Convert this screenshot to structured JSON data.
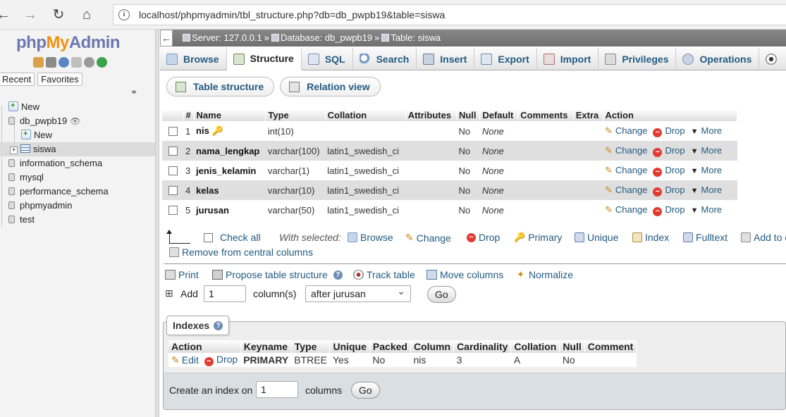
{
  "browser": {
    "url": "localhost/phpmyadmin/tbl_structure.php?db=db_pwpb19&table=siswa"
  },
  "logo": {
    "php": "php",
    "my": "My",
    "admin": "Admin"
  },
  "nav": {
    "recent_tab": "Recent",
    "favorites_tab": "Favorites",
    "tree": [
      {
        "label": "New"
      },
      {
        "label": "db_pwpb19"
      },
      {
        "label": "New"
      },
      {
        "label": "siswa"
      },
      {
        "label": "information_schema"
      },
      {
        "label": "mysql"
      },
      {
        "label": "performance_schema"
      },
      {
        "label": "phpmyadmin"
      },
      {
        "label": "test"
      }
    ]
  },
  "breadcrumb": {
    "server": "Server: 127.0.0.1",
    "database": "Database: db_pwpb19",
    "table": "Table: siswa"
  },
  "tabs": [
    "Browse",
    "Structure",
    "SQL",
    "Search",
    "Insert",
    "Export",
    "Import",
    "Privileges",
    "Operations"
  ],
  "subtabs": [
    "Table structure",
    "Relation view"
  ],
  "structure": {
    "headers": [
      "#",
      "Name",
      "Type",
      "Collation",
      "Attributes",
      "Null",
      "Default",
      "Comments",
      "Extra",
      "Action"
    ],
    "rows": [
      {
        "num": "1",
        "name": "nis",
        "type": "int(10)",
        "collation": "",
        "null": "No",
        "default": "None"
      },
      {
        "num": "2",
        "name": "nama_lengkap",
        "type": "varchar(100)",
        "collation": "latin1_swedish_ci",
        "null": "No",
        "default": "None"
      },
      {
        "num": "3",
        "name": "jenis_kelamin",
        "type": "varchar(1)",
        "collation": "latin1_swedish_ci",
        "null": "No",
        "default": "None"
      },
      {
        "num": "4",
        "name": "kelas",
        "type": "varchar(10)",
        "collation": "latin1_swedish_ci",
        "null": "No",
        "default": "None"
      },
      {
        "num": "5",
        "name": "jurusan",
        "type": "varchar(50)",
        "collation": "latin1_swedish_ci",
        "null": "No",
        "default": "None"
      }
    ],
    "actions": {
      "change": "Change",
      "drop": "Drop",
      "more": "More"
    }
  },
  "with_selected": {
    "check_all": "Check all",
    "label": "With selected:",
    "browse": "Browse",
    "change": "Change",
    "drop": "Drop",
    "primary": "Primary",
    "unique": "Unique",
    "index": "Index",
    "fulltext": "Fulltext",
    "add_central": "Add to c",
    "remove_central": "Remove from central columns"
  },
  "tools": {
    "print": "Print",
    "propose": "Propose table structure",
    "track": "Track table",
    "move": "Move columns",
    "normalize": "Normalize"
  },
  "add_columns": {
    "label": "Add",
    "count": "1",
    "unit": "column(s)",
    "position": "after jurusan",
    "go": "Go"
  },
  "indexes": {
    "legend": "Indexes",
    "headers": [
      "Action",
      "Keyname",
      "Type",
      "Unique",
      "Packed",
      "Column",
      "Cardinality",
      "Collation",
      "Null",
      "Comment"
    ],
    "row": {
      "edit": "Edit",
      "drop": "Drop",
      "keyname": "PRIMARY",
      "type": "BTREE",
      "unique": "Yes",
      "packed": "No",
      "column": "nis",
      "cardinality": "3",
      "collation": "A",
      "null": "No",
      "comment": ""
    },
    "create_label": "Create an index on",
    "create_count": "1",
    "columns_label": "columns",
    "go": "Go"
  }
}
